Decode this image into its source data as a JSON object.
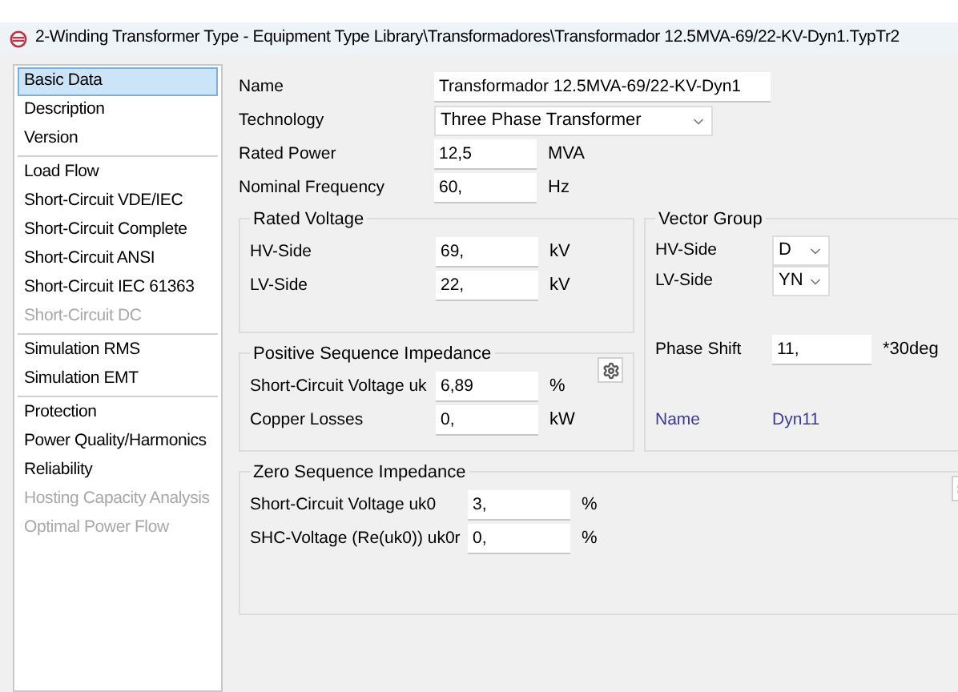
{
  "window": {
    "title": "2-Winding Transformer Type - Equipment Type Library\\Transformadores\\Transformador 12.5MVA-69/22-KV-Dyn1.TypTr2"
  },
  "sidebar": {
    "groups": [
      [
        {
          "label": "Basic Data",
          "selected": true,
          "disabled": false
        },
        {
          "label": "Description",
          "selected": false,
          "disabled": false
        },
        {
          "label": "Version",
          "selected": false,
          "disabled": false
        }
      ],
      [
        {
          "label": "Load Flow",
          "selected": false,
          "disabled": false
        },
        {
          "label": "Short-Circuit VDE/IEC",
          "selected": false,
          "disabled": false
        },
        {
          "label": "Short-Circuit Complete",
          "selected": false,
          "disabled": false
        },
        {
          "label": "Short-Circuit ANSI",
          "selected": false,
          "disabled": false
        },
        {
          "label": "Short-Circuit IEC 61363",
          "selected": false,
          "disabled": false
        },
        {
          "label": "Short-Circuit DC",
          "selected": false,
          "disabled": true
        }
      ],
      [
        {
          "label": "Simulation RMS",
          "selected": false,
          "disabled": false
        },
        {
          "label": "Simulation EMT",
          "selected": false,
          "disabled": false
        }
      ],
      [
        {
          "label": "Protection",
          "selected": false,
          "disabled": false
        },
        {
          "label": "Power Quality/Harmonics",
          "selected": false,
          "disabled": false
        },
        {
          "label": "Reliability",
          "selected": false,
          "disabled": false
        },
        {
          "label": "Hosting Capacity Analysis",
          "selected": false,
          "disabled": true
        },
        {
          "label": "Optimal Power Flow",
          "selected": false,
          "disabled": true
        }
      ]
    ]
  },
  "form": {
    "name": {
      "label": "Name",
      "value": "Transformador 12.5MVA-69/22-KV-Dyn1"
    },
    "technology": {
      "label": "Technology",
      "value": "Three Phase Transformer"
    },
    "rated_power": {
      "label": "Rated Power",
      "value": "12,5",
      "unit": "MVA"
    },
    "nominal_frequency": {
      "label": "Nominal Frequency",
      "value": "60,",
      "unit": "Hz"
    }
  },
  "rated_voltage": {
    "title": "Rated Voltage",
    "rows": [
      {
        "label": "HV-Side",
        "value": "69,",
        "unit": "kV"
      },
      {
        "label": "LV-Side",
        "value": "22,",
        "unit": "kV"
      }
    ]
  },
  "vector_group": {
    "title": "Vector Group",
    "hv": {
      "label": "HV-Side",
      "value": "D"
    },
    "lv": {
      "label": "LV-Side",
      "value": "YN"
    },
    "phase_shift": {
      "label": "Phase Shift",
      "value": "11,",
      "unit": "*30deg"
    },
    "name": {
      "label": "Name",
      "value": "Dyn11"
    }
  },
  "positive_sequence": {
    "title": "Positive Sequence Impedance",
    "rows": [
      {
        "label": "Short-Circuit Voltage uk",
        "value": "6,89",
        "unit": "%"
      },
      {
        "label": "Copper Losses",
        "value": "0,",
        "unit": "kW"
      }
    ]
  },
  "zero_sequence": {
    "title": "Zero Sequence Impedance",
    "rows": [
      {
        "label": "Short-Circuit Voltage uk0",
        "value": "3,",
        "unit": "%"
      },
      {
        "label": "SHC-Voltage (Re(uk0)) uk0r",
        "value": "0,",
        "unit": "%"
      }
    ]
  }
}
